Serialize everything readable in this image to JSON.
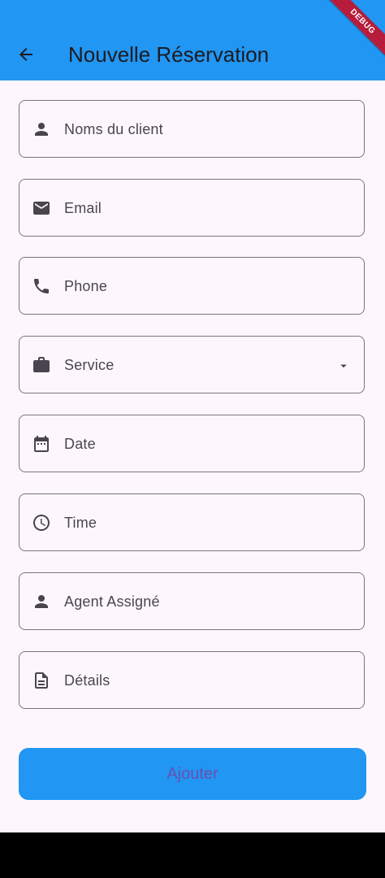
{
  "appbar": {
    "title": "Nouvelle Réservation",
    "back_icon": "arrow-back-icon",
    "debug_banner": "DEBUG",
    "background": "#2196f3"
  },
  "form": {
    "fields": [
      {
        "label": "Noms du client",
        "icon": "person-icon"
      },
      {
        "label": "Email",
        "icon": "email-icon"
      },
      {
        "label": "Phone",
        "icon": "phone-icon"
      },
      {
        "label": "Service",
        "icon": "briefcase-icon",
        "dropdown": true
      },
      {
        "label": "Date",
        "icon": "calendar-icon"
      },
      {
        "label": "Time",
        "icon": "clock-icon"
      },
      {
        "label": "Agent Assigné",
        "icon": "person-icon"
      },
      {
        "label": "Détails",
        "icon": "document-icon"
      }
    ],
    "submit_label": "Ajouter"
  },
  "colors": {
    "accent": "#2196f3",
    "background": "#fdf7fd",
    "button_text": "#6b4fb0",
    "debug": "#b71c3b"
  }
}
